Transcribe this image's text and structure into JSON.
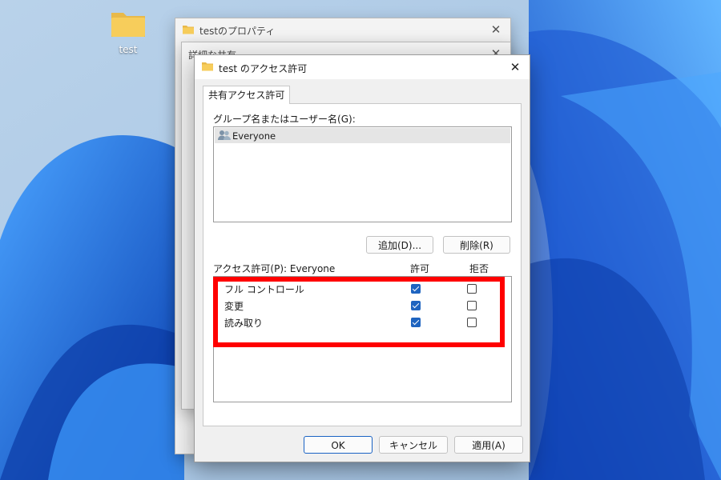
{
  "desktop": {
    "icon_label": "test"
  },
  "windows": {
    "properties_title": "testのプロパティ",
    "advanced_title": "詳細な共有"
  },
  "dialog": {
    "title": "test のアクセス許可",
    "tab_label": "共有アクセス許可",
    "group_label": "グループ名またはユーザー名(G):",
    "users": [
      "Everyone"
    ],
    "add_button": "追加(D)...",
    "remove_button": "削除(R)",
    "permissions_header": "アクセス許可(P): Everyone",
    "allow_header": "許可",
    "deny_header": "拒否",
    "permissions": [
      {
        "name": "フル コントロール",
        "allow": true,
        "deny": false
      },
      {
        "name": "変更",
        "allow": true,
        "deny": false
      },
      {
        "name": "読み取り",
        "allow": true,
        "deny": false
      }
    ],
    "ok_button": "OK",
    "cancel_button": "キャンセル",
    "apply_button": "適用(A)"
  },
  "colors": {
    "accent": "#1e64c0",
    "highlight_box": "#ff0000",
    "wallpaper_base": "#a9c7e3",
    "wallpaper_bloom": "#1f63d4"
  }
}
